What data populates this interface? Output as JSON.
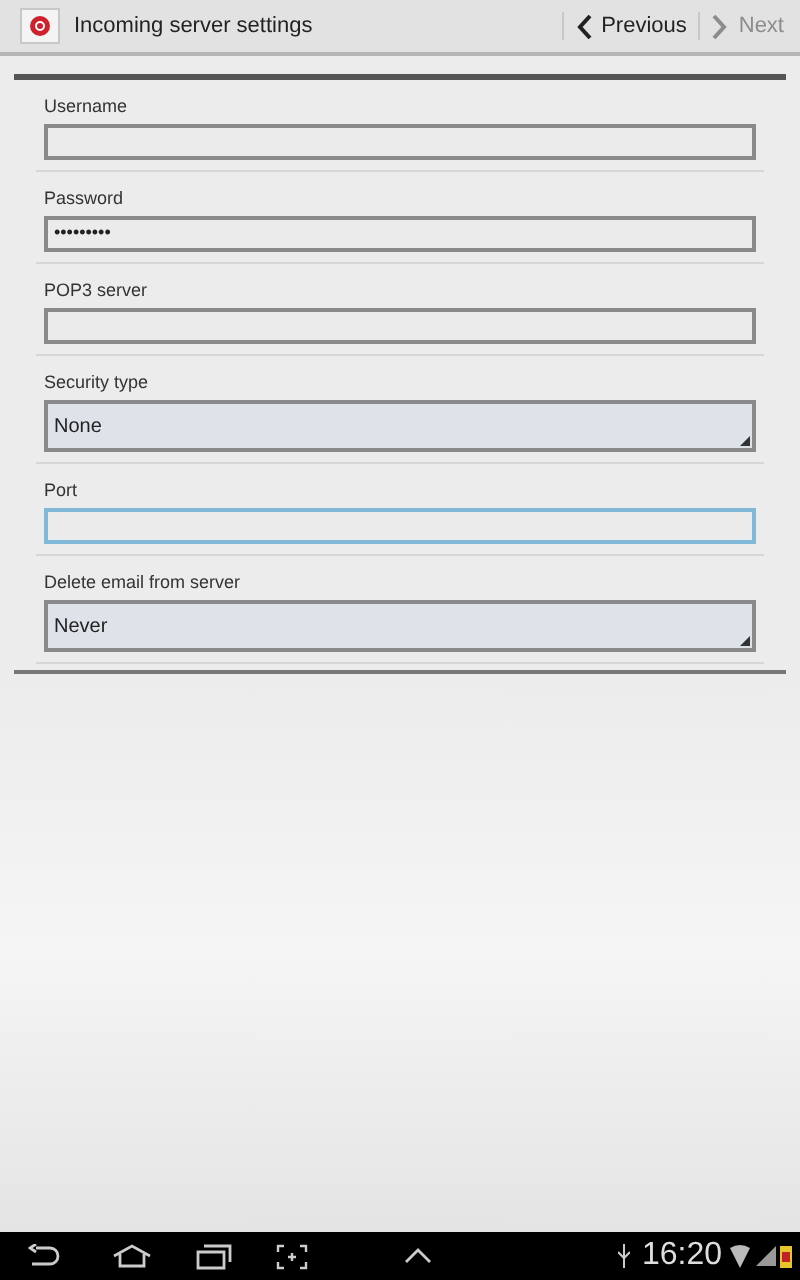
{
  "header": {
    "title": "Incoming server settings",
    "previous": {
      "label": "Previous",
      "disabled": false
    },
    "next": {
      "label": "Next",
      "disabled": true
    }
  },
  "fields": [
    {
      "kind": "text",
      "label": "Username",
      "focused": false
    },
    {
      "kind": "text",
      "label": "Password",
      "value": "•••••••••",
      "focused": false
    },
    {
      "kind": "text",
      "label": "POP3 server",
      "focused": false
    },
    {
      "kind": "select",
      "label": "Security type",
      "value": "None",
      "focused": false
    },
    {
      "kind": "text",
      "label": "Port",
      "focused": true
    },
    {
      "kind": "select",
      "label": "Delete email from server",
      "value": "Never",
      "focused": false
    }
  ],
  "status_bar": {
    "time": "16:20"
  }
}
